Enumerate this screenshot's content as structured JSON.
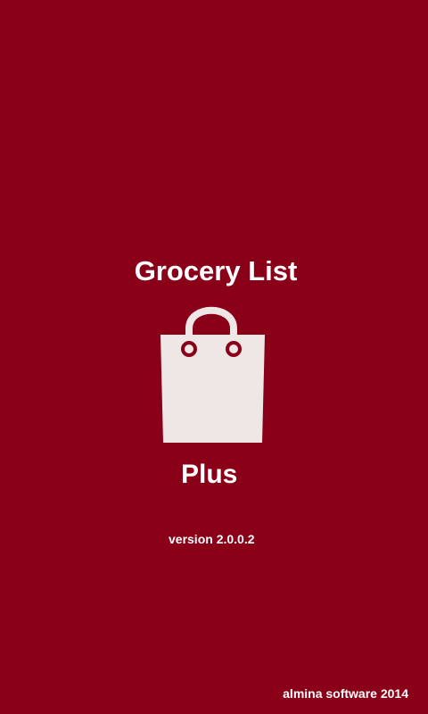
{
  "splash": {
    "title": "Grocery List",
    "subtitle": "Plus",
    "version": "version 2.0.0.2",
    "company": "almina software 2014",
    "icon": "shopping-bag-icon"
  },
  "colors": {
    "background": "#8a0019",
    "text": "#ffffff",
    "bag": "#efe6e6"
  }
}
